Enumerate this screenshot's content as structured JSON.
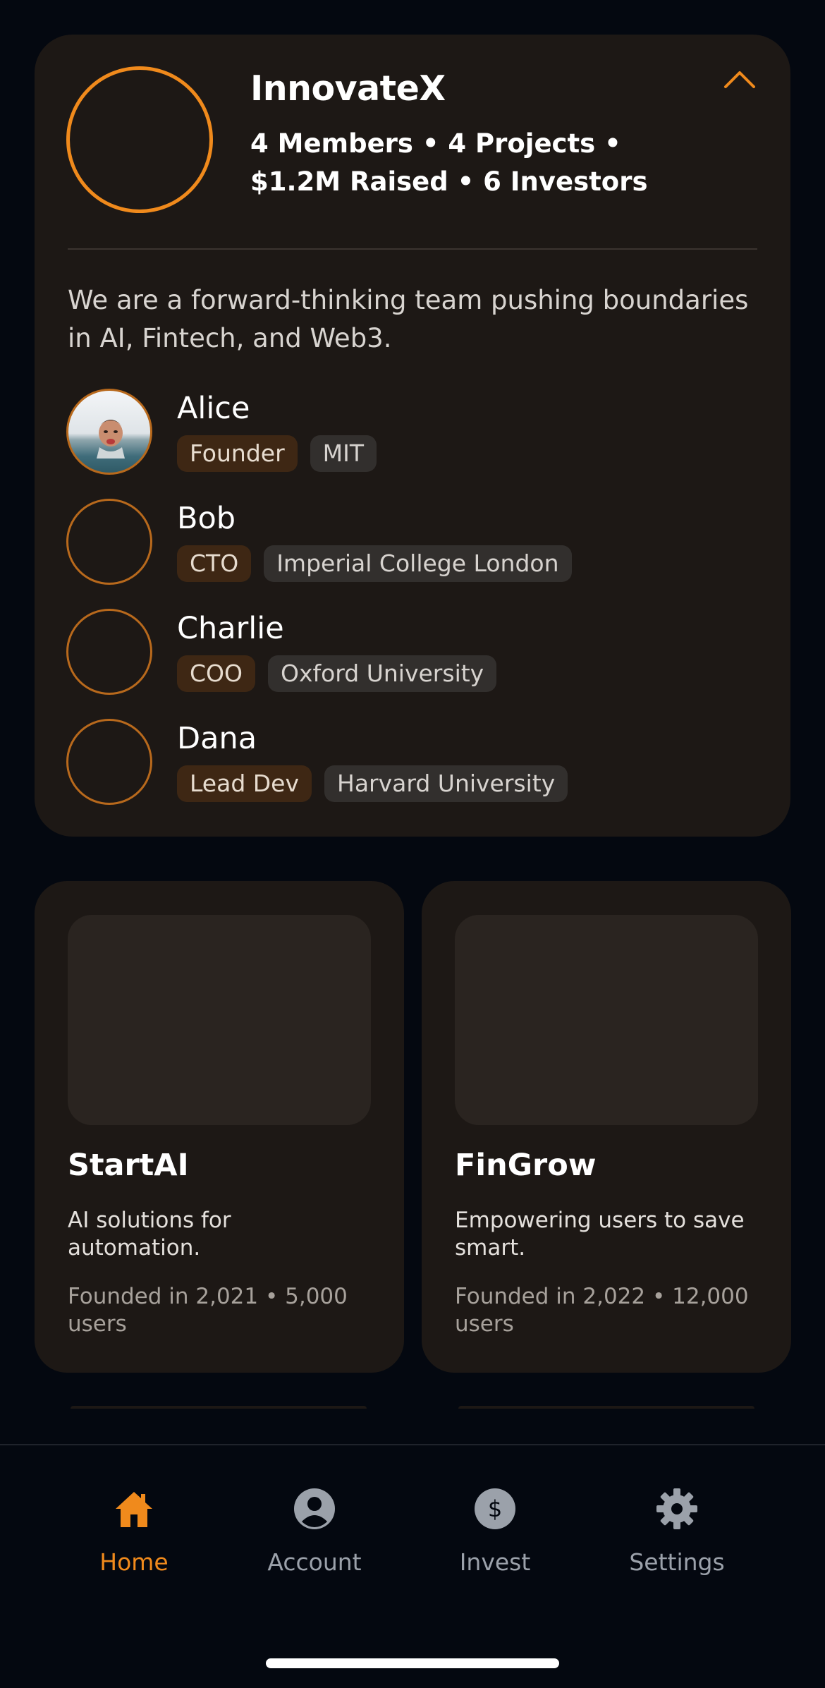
{
  "team": {
    "name": "InnovateX",
    "stats_line1": "4 Members • 4 Projects •",
    "stats_line2": "$1.2M Raised • 6 Investors",
    "description": "We are a forward-thinking team pushing boundaries in AI, Fintech, and Web3.",
    "members": [
      {
        "name": "Alice",
        "role": "Founder",
        "school": "MIT"
      },
      {
        "name": "Bob",
        "role": "CTO",
        "school": "Imperial College London"
      },
      {
        "name": "Charlie",
        "role": "COO",
        "school": "Oxford University"
      },
      {
        "name": "Dana",
        "role": "Lead Dev",
        "school": "Harvard University"
      }
    ]
  },
  "projects": [
    {
      "title": "StartAI",
      "description": "AI solutions for automation.",
      "meta": "Founded in 2,021 • 5,000 users"
    },
    {
      "title": "FinGrow",
      "description": "Empowering users to save smart.",
      "meta": "Founded in 2,022 • 12,000 users"
    }
  ],
  "nav": {
    "items": [
      {
        "label": "Home",
        "icon": "home-icon",
        "active": true
      },
      {
        "label": "Account",
        "icon": "account-icon"
      },
      {
        "label": "Invest",
        "icon": "dollar-icon"
      },
      {
        "label": "Settings",
        "icon": "gear-icon"
      }
    ]
  },
  "colors": {
    "accent": "#f08a1c",
    "background": "#040810",
    "card": "#1d1815"
  }
}
